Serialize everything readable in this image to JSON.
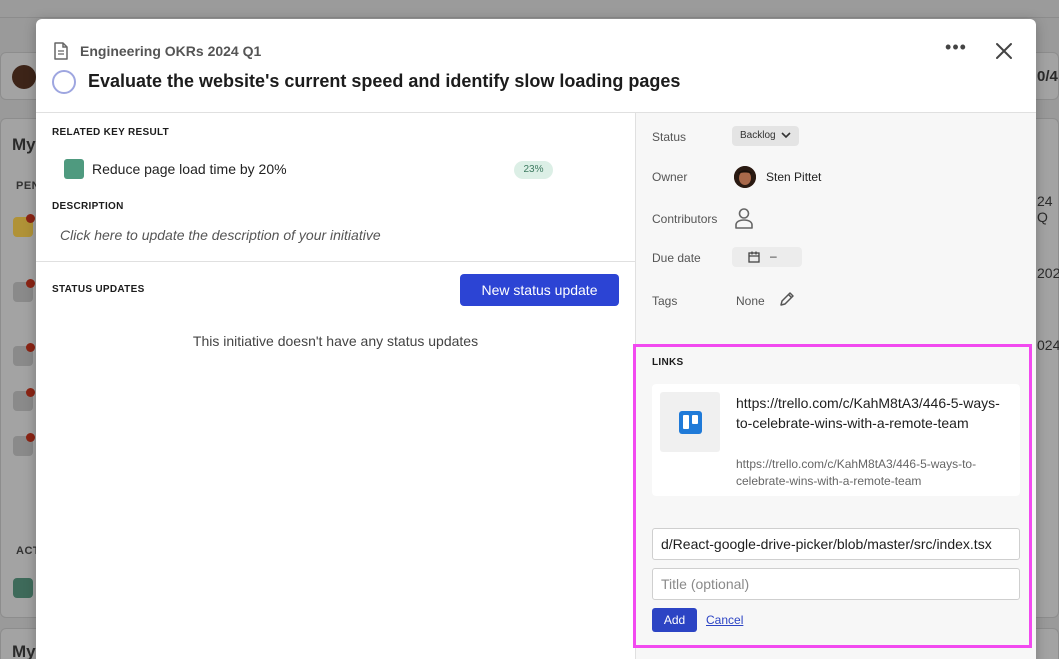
{
  "background": {
    "card1_text": "0/4",
    "card2_title": "My",
    "pending_label": "PEN",
    "side_text_1": "24 Q",
    "side_text_2": "202",
    "side_text_3": "024",
    "activity_label": "ACT",
    "card3_title": "My"
  },
  "header": {
    "breadcrumb": "Engineering OKRs 2024 Q1",
    "title": "Evaluate the website's current speed and identify slow loading pages",
    "more_label": "•••"
  },
  "related": {
    "label": "RELATED KEY RESULT",
    "key_result": "Reduce page load time by 20%",
    "progress": "23%",
    "color": "#4f9a7f"
  },
  "description": {
    "label": "DESCRIPTION",
    "placeholder": "Click here to update the description of your initiative"
  },
  "status_updates": {
    "label": "STATUS UPDATES",
    "button": "New status update",
    "empty": "This initiative doesn't have any status updates"
  },
  "properties": {
    "status_label": "Status",
    "status_value": "Backlog",
    "owner_label": "Owner",
    "owner_name": "Sten Pittet",
    "contributors_label": "Contributors",
    "due_label": "Due date",
    "due_value": "–",
    "tags_label": "Tags",
    "tags_value": "None"
  },
  "links": {
    "label": "LINKS",
    "items": [
      {
        "title": "https://trello.com/c/KahM8tA3/446-5-ways-to-celebrate-wins-with-a-remote-team",
        "url": "https://trello.com/c/KahM8tA3/446-5-ways-to-celebrate-wins-with-a-remote-team"
      }
    ],
    "url_input_value": "d/React-google-drive-picker/blob/master/src/index.tsx",
    "title_placeholder": "Title (optional)",
    "add_button": "Add",
    "cancel": "Cancel",
    "highlight_color": "#f24af0"
  }
}
